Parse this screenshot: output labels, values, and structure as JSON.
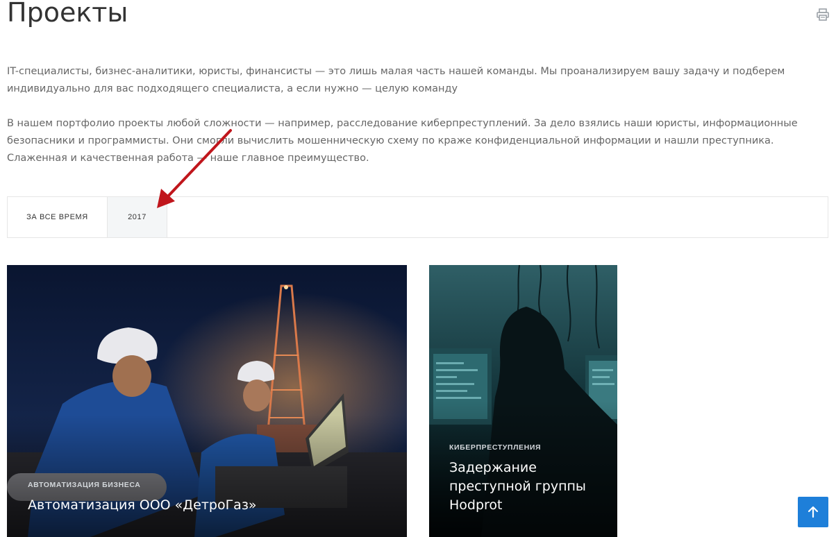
{
  "page": {
    "title": "Проекты"
  },
  "toolbar": {
    "print_icon": "printer-icon"
  },
  "intro": {
    "paragraph_1": "IT-специалисты, бизнес-аналитики, юристы, финансисты — это лишь малая часть нашей команды. Мы проанализируем вашу задачу и подберем индивидуально для вас подходящего специалиста, а если нужно — целую команду",
    "paragraph_2": "В нашем портфолио проекты любой сложности — например, расследование киберпреступлений. За дело взялись наши юристы, информационные безопасники и программисты. Они смогли вычислить мошенническую схему по краже конфиденциальной информации и нашли преступника. Слаженная и качественная работа — наше главное преимущество."
  },
  "filters": {
    "all_label": "ЗА ВСЕ ВРЕМЯ",
    "year_label": "2017"
  },
  "projects": [
    {
      "category": "АВТОМАТИЗАЦИЯ БИЗНЕСА",
      "title": "Автоматизация ООО «ДетроГаз»",
      "helmet_logo": "detrogaz"
    },
    {
      "category": "КИБЕРПРЕСТУПЛЕНИЯ",
      "title": "Задержание преступной группы Hodprot"
    }
  ],
  "colors": {
    "accent": "#1e7fd9",
    "annotation_arrow": "#c0161c",
    "text_muted": "#666666",
    "title": "#333333"
  },
  "scroll_top": {
    "icon": "arrow-up-icon"
  }
}
